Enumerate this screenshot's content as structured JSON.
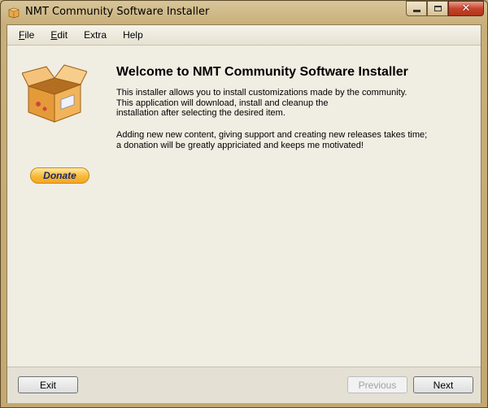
{
  "window": {
    "title": "NMT Community Software Installer",
    "icon": "box-icon"
  },
  "menu": [
    {
      "label": "File",
      "accel": "F",
      "rest": "ile"
    },
    {
      "label": "Edit",
      "accel": "E",
      "rest": "dit"
    },
    {
      "label": "Extra",
      "accel": "",
      "rest": "Extra"
    },
    {
      "label": "Help",
      "accel": "",
      "rest": "Help"
    }
  ],
  "welcome": {
    "title": "Welcome to NMT Community Software Installer",
    "paragraph1": "This installer allows you to install customizations made by the community.\nThis application will download, install and cleanup the\ninstallation after selecting the desired item.",
    "paragraph2": "Adding new new content, giving support and creating new releases takes time;\na donation will be greatly appriciated and keeps me motivated!"
  },
  "donate_label": "Donate",
  "buttons": {
    "exit": "Exit",
    "previous": "Previous",
    "next": "Next"
  },
  "colors": {
    "donate_bg": "#f7b936",
    "client_bg": "#f0ede2"
  }
}
